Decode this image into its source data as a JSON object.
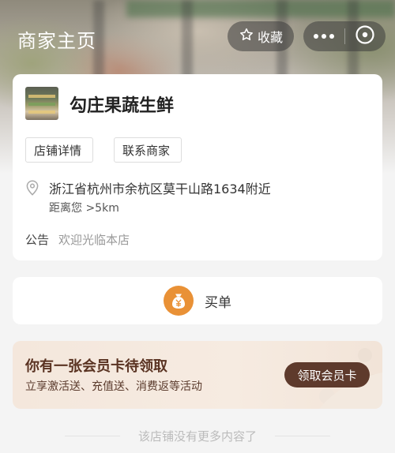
{
  "header": {
    "title": "商家主页",
    "favorite_label": "收藏"
  },
  "store": {
    "name": "勾庄果蔬生鲜",
    "tags": {
      "detail": "店铺详情",
      "contact": "联系商家"
    },
    "address": "浙江省杭州市余杭区莫干山路1634附近",
    "distance": "距离您 >5km",
    "notice_label": "公告",
    "notice_text": "欢迎光临本店"
  },
  "pay": {
    "label": "买单",
    "icon": "yen-bag-icon",
    "icon_color": "#e99136"
  },
  "member": {
    "title": "你有一张会员卡待领取",
    "subtitle": "立享激活送、充值送、消费返等活动",
    "button_label": "领取会员卡",
    "accent": "#5e3a2c"
  },
  "footer": {
    "text": "该店铺没有更多内容了"
  }
}
